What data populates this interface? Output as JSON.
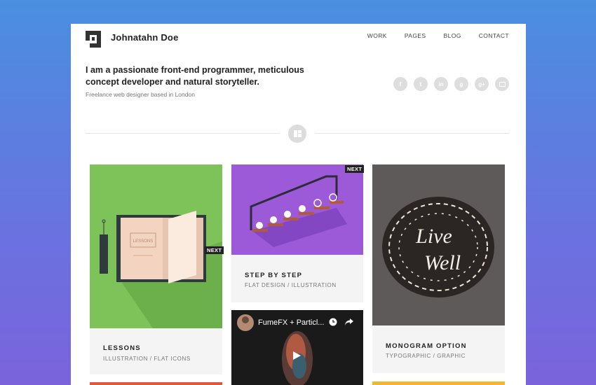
{
  "brand": {
    "name": "Johnatahn Doe",
    "logo_icon": "logo-mark-icon"
  },
  "nav": {
    "items": [
      "WORK",
      "PAGES",
      "BLOG",
      "CONTACT"
    ]
  },
  "intro": {
    "headline": "I am a passionate front-end programmer, meticulous concept developer and natural storyteller.",
    "subline": "Freelance web designer based in London"
  },
  "socials": [
    {
      "icon": "facebook-icon",
      "glyph": "f"
    },
    {
      "icon": "twitter-icon",
      "glyph": "t"
    },
    {
      "icon": "linkedin-icon",
      "glyph": "in"
    },
    {
      "icon": "google-icon",
      "glyph": "g"
    },
    {
      "icon": "google-plus-icon",
      "glyph": "g+"
    },
    {
      "icon": "mail-icon",
      "glyph": ""
    }
  ],
  "divider": {
    "icon": "grid-icon"
  },
  "cards": {
    "lessons": {
      "title": "LESSONS",
      "cats": "ILLUSTRATION / FLAT ICONS",
      "badge": "NEXT",
      "book_text": "LESSONS",
      "bg": "#7dc35a"
    },
    "steps": {
      "title": "STEP BY STEP",
      "cats": "FLAT DESIGN / ILLUSTRATION",
      "badge": "NEXT",
      "bg": "#9d5ad8"
    },
    "monogram": {
      "title": "MONOGRAM OPTION",
      "cats": "TYPOGRAPHIC / GRAPHIC",
      "art_line1": "Live",
      "art_line2": "Well",
      "bg": "#5e5a5a"
    },
    "video": {
      "title": "FumeFX + Particl...",
      "icons": [
        "clock-icon",
        "share-icon",
        "play-icon"
      ]
    }
  }
}
